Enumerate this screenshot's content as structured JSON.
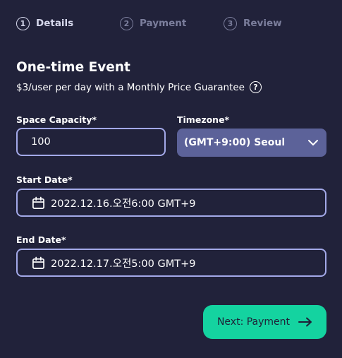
{
  "stepper": {
    "steps": [
      {
        "number": "1",
        "label": "Details",
        "state": "active"
      },
      {
        "number": "2",
        "label": "Payment",
        "state": "inactive"
      },
      {
        "number": "3",
        "label": "Review",
        "state": "inactive"
      }
    ]
  },
  "header": {
    "title": "One-time Event",
    "subtitle": "$3/user per day with a Monthly Price Guarantee",
    "help_icon": "?"
  },
  "form": {
    "capacity": {
      "label": "Space Capacity*",
      "value": "100"
    },
    "timezone": {
      "label": "Timezone*",
      "value": "(GMT+9:00) Seoul"
    },
    "start_date": {
      "label": "Start Date*",
      "value": "2022.12.16.오전6:00 GMT+9",
      "icon": "calendar-icon"
    },
    "end_date": {
      "label": "End Date*",
      "value": "2022.12.17.오전5:00 GMT+9",
      "icon": "calendar-icon"
    }
  },
  "actions": {
    "next_label": "Next: Payment",
    "next_icon": "arrow-right-icon"
  },
  "colors": {
    "background": "#21223a",
    "field_border": "#a3a9e8",
    "select_bg": "#5c6299",
    "accent": "#14d3a0",
    "muted": "#7b7e9c"
  }
}
